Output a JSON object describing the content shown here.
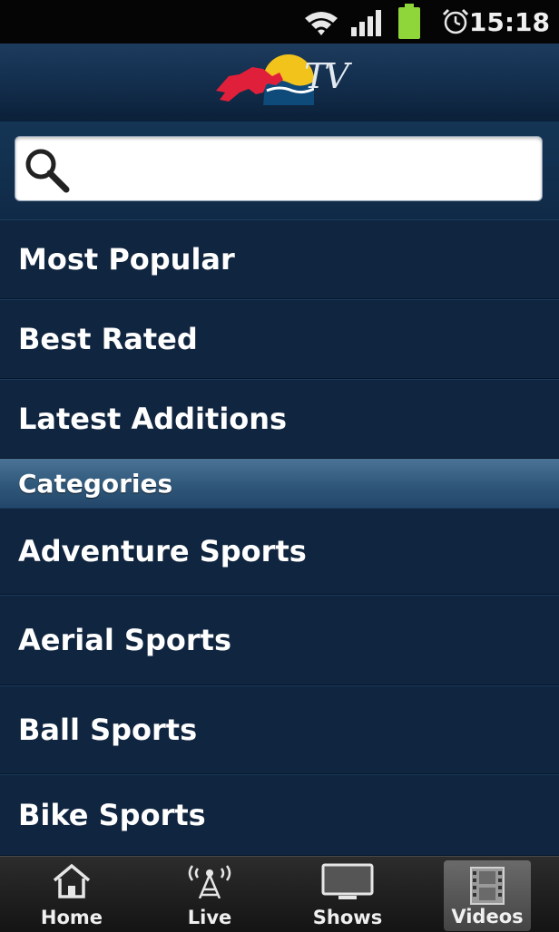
{
  "status_bar": {
    "time": "15:18",
    "icons": [
      "wifi-icon",
      "signal-icon",
      "battery-icon",
      "alarm-icon"
    ]
  },
  "header": {
    "logo_text": "TV",
    "logo_icon": "red-bull-logo-icon"
  },
  "search": {
    "icon": "search-icon",
    "value": "",
    "placeholder": ""
  },
  "menu": {
    "items": [
      {
        "label": "Most Popular"
      },
      {
        "label": "Best Rated"
      },
      {
        "label": "Latest Additions"
      }
    ]
  },
  "categories": {
    "header": "Categories",
    "items": [
      {
        "label": "Adventure Sports"
      },
      {
        "label": "Aerial Sports"
      },
      {
        "label": "Ball Sports"
      },
      {
        "label": "Bike Sports"
      }
    ]
  },
  "tabs": {
    "items": [
      {
        "label": "Home",
        "icon": "home-icon"
      },
      {
        "label": "Live",
        "icon": "broadcast-tower-icon"
      },
      {
        "label": "Shows",
        "icon": "tv-screen-icon"
      },
      {
        "label": "Videos",
        "icon": "film-strip-icon",
        "active": true
      }
    ]
  },
  "colors": {
    "background": "#0f2440",
    "category_header": "#2f5779",
    "status_bar": "#050505",
    "battery": "#8fd63a",
    "logo_red": "#e0203a",
    "logo_yellow": "#f2c31b"
  }
}
